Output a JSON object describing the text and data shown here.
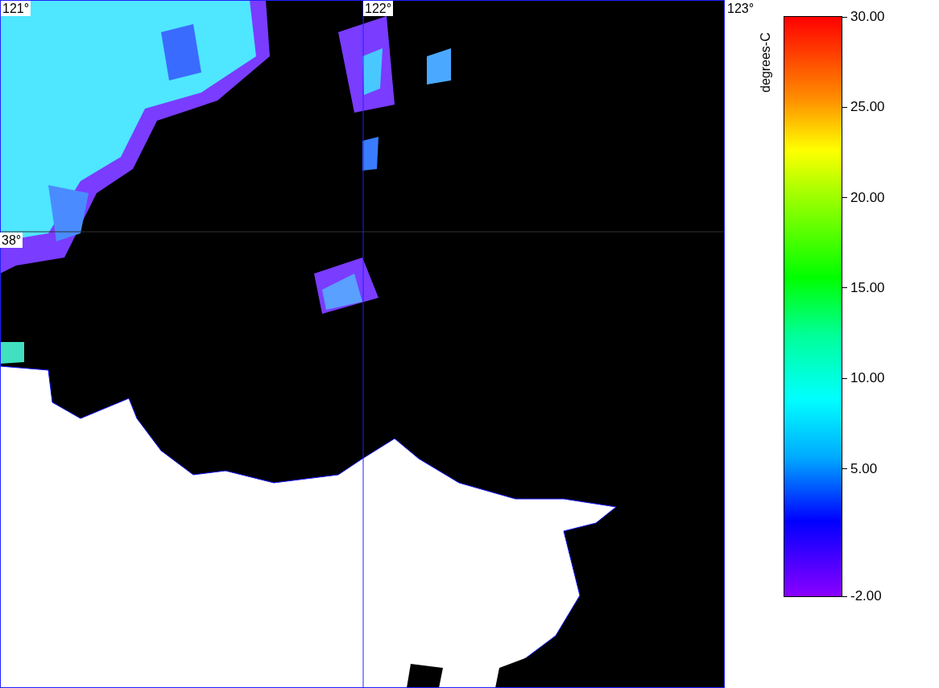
{
  "map": {
    "grid_labels": [
      {
        "label": "121°",
        "kind": "lon"
      },
      {
        "label": "122°",
        "kind": "lon"
      },
      {
        "label": "123°",
        "kind": "lon"
      },
      {
        "label": "38°",
        "kind": "lat"
      }
    ]
  },
  "colorbar": {
    "unit": "degrees-C",
    "ticks": [
      "30.00",
      "25.00",
      "20.00",
      "15.00",
      "10.00",
      "5.00",
      "-2.00"
    ]
  }
}
